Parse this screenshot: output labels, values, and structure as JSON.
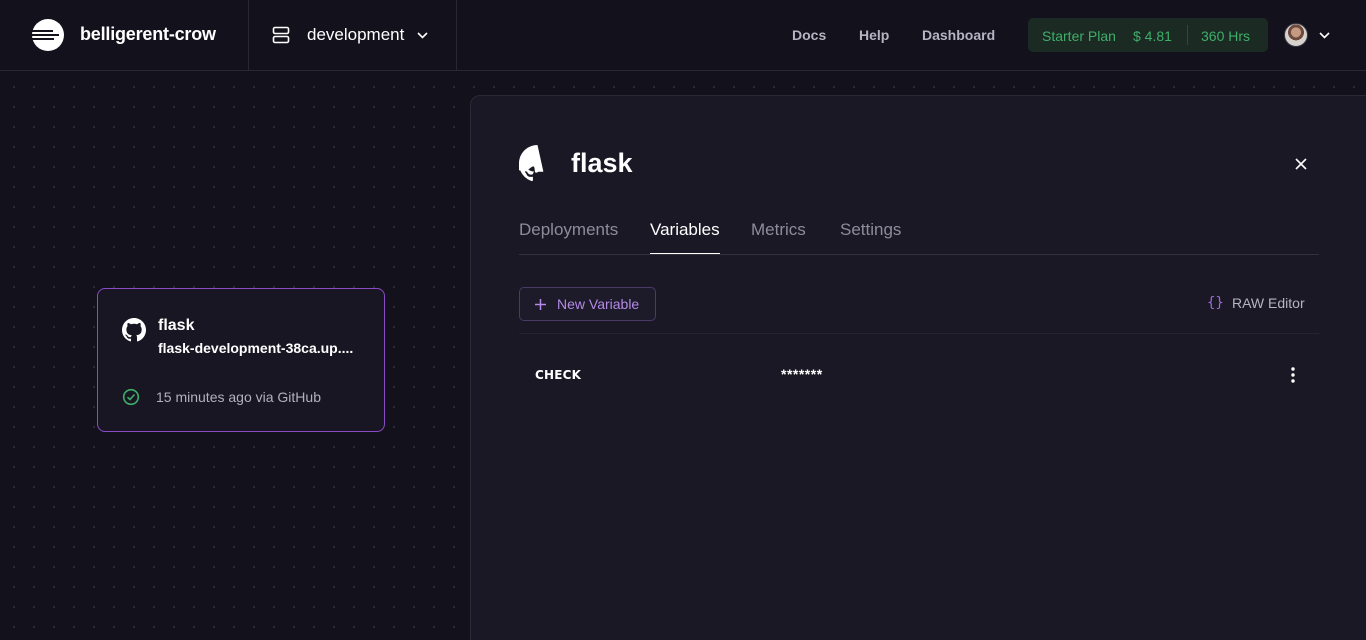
{
  "project": {
    "name": "belligerent-crow",
    "environment": "development"
  },
  "nav": {
    "docs": "Docs",
    "help": "Help",
    "dashboard": "Dashboard"
  },
  "plan": {
    "name": "Starter Plan",
    "cost": "$ 4.81",
    "hours": "360 Hrs",
    "color": "#3fae6a"
  },
  "service_card": {
    "title": "flask",
    "url": "flask-development-38ca.up....",
    "status": "15 minutes ago via GitHub"
  },
  "panel": {
    "title": "flask",
    "tabs": [
      {
        "label": "Deployments",
        "active": false
      },
      {
        "label": "Variables",
        "active": true
      },
      {
        "label": "Metrics",
        "active": false
      },
      {
        "label": "Settings",
        "active": false
      }
    ],
    "new_variable_label": "New Variable",
    "raw_editor_icon": "{}",
    "raw_editor_label": "RAW Editor",
    "variables": [
      {
        "name": "CHECK",
        "value": "*******"
      }
    ]
  },
  "colors": {
    "background": "#13111c",
    "accent_purple": "#8a4bc7",
    "panel_bg": "#1a1824"
  }
}
